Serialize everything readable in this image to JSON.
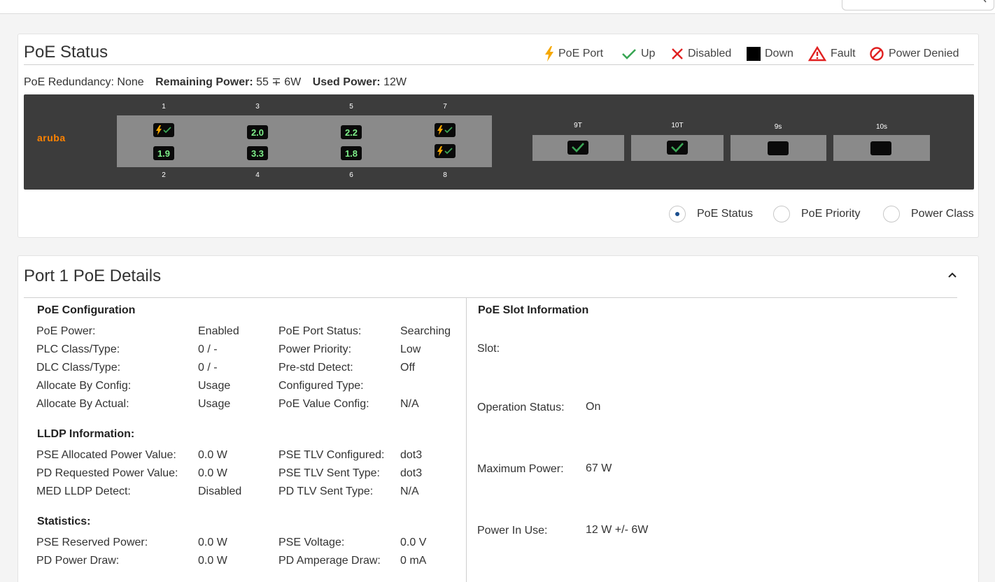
{
  "poe_status": {
    "title": "PoE Status",
    "legend": {
      "poe_port": "PoE Port",
      "up": "Up",
      "disabled": "Disabled",
      "down": "Down",
      "fault": "Fault",
      "power_denied": "Power Denied"
    },
    "summary": {
      "redundancy": "PoE Redundancy: None",
      "remaining_label": "Remaining Power:",
      "remaining_value": "55 ∓ 6W",
      "used_label": "Used Power:",
      "used_value": "12W"
    },
    "switch": {
      "logo": "aruba",
      "ports": [
        {
          "number": "1",
          "display": "poe-up"
        },
        {
          "number": "2",
          "display": "1.9"
        },
        {
          "number": "3",
          "display": "2.0"
        },
        {
          "number": "4",
          "display": "3.3"
        },
        {
          "number": "5",
          "display": "2.2"
        },
        {
          "number": "6",
          "display": "1.8"
        },
        {
          "number": "7",
          "display": "poe-up"
        },
        {
          "number": "8",
          "display": "poe-up"
        }
      ],
      "uplinks": [
        {
          "label": "9T",
          "state": "up"
        },
        {
          "label": "10T",
          "state": "up"
        },
        {
          "label": "9s",
          "state": "down"
        },
        {
          "label": "10s",
          "state": "down"
        }
      ]
    },
    "view_options": {
      "poe_status": "PoE Status",
      "poe_priority": "PoE Priority",
      "power_class": "Power Class",
      "selected": "PoE Status"
    },
    "colors": {
      "poe_port": "#f6a800",
      "up": "#3aa655",
      "disabled": "#e02020",
      "down": "#000000",
      "fault": "#e02020",
      "power_denied": "#e02020",
      "logo": "#ff8300"
    }
  },
  "port_details": {
    "title": "Port 1 PoE Details",
    "config": {
      "title": "PoE Configuration",
      "left": [
        {
          "label": "PoE Power:",
          "value": "Enabled"
        },
        {
          "label": "PLC Class/Type:",
          "value": "0 / -"
        },
        {
          "label": "DLC Class/Type:",
          "value": "0 / -"
        },
        {
          "label": "Allocate By Config:",
          "value": "Usage"
        },
        {
          "label": "Allocate By Actual:",
          "value": "Usage"
        }
      ],
      "right": [
        {
          "label": "PoE Port Status:",
          "value": "Searching"
        },
        {
          "label": "Power Priority:",
          "value": "Low"
        },
        {
          "label": "Pre-std Detect:",
          "value": "Off"
        },
        {
          "label": "Configured Type:",
          "value": ""
        },
        {
          "label": "PoE Value Config:",
          "value": "N/A"
        }
      ]
    },
    "lldp": {
      "title": "LLDP Information:",
      "left": [
        {
          "label": "PSE Allocated Power Value:",
          "value": "0.0 W"
        },
        {
          "label": "PD Requested Power Value:",
          "value": "0.0 W"
        },
        {
          "label": "MED LLDP Detect:",
          "value": "Disabled"
        }
      ],
      "right": [
        {
          "label": "PSE TLV Configured:",
          "value": "dot3"
        },
        {
          "label": "PSE TLV Sent Type:",
          "value": "dot3"
        },
        {
          "label": "PD TLV Sent Type:",
          "value": "N/A"
        }
      ]
    },
    "stats": {
      "title": "Statistics:",
      "left": [
        {
          "label": "PSE Reserved Power:",
          "value": "0.0 W"
        },
        {
          "label": "PD Power Draw:",
          "value": "0.0 W"
        }
      ],
      "right": [
        {
          "label": "PSE Voltage:",
          "value": "0.0 V"
        },
        {
          "label": "PD Amperage Draw:",
          "value": "0 mA"
        }
      ]
    },
    "slot": {
      "title": "PoE Slot Information",
      "rows": [
        {
          "label": "Slot:",
          "value": ""
        },
        {
          "label": "Operation Status:",
          "value": "On"
        },
        {
          "label": "Maximum Power:",
          "value": "67 W"
        },
        {
          "label": "Power In Use:",
          "value": "12 W +/- 6W"
        }
      ]
    }
  }
}
